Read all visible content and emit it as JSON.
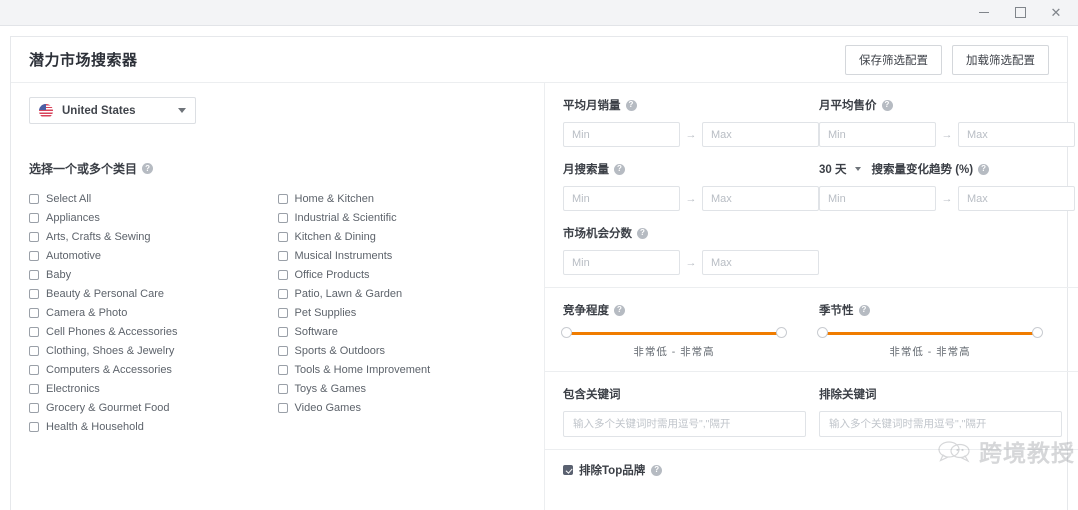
{
  "window": {
    "minimize_label": "—",
    "maximize_label": "□",
    "close_label": "✕"
  },
  "header": {
    "title": "潜力市场搜索器",
    "save_button": "保存筛选配置",
    "load_button": "加载筛选配置"
  },
  "country": {
    "label": "United States",
    "icon": "us-flag-icon"
  },
  "categories": {
    "section_label": "选择一个或多个类目",
    "column1": [
      "Select All",
      "Appliances",
      "Arts, Crafts & Sewing",
      "Automotive",
      "Baby",
      "Beauty & Personal Care",
      "Camera & Photo",
      "Cell Phones & Accessories",
      "Clothing, Shoes & Jewelry",
      "Computers & Accessories",
      "Electronics",
      "Grocery & Gourmet Food",
      "Health & Household"
    ],
    "column2": [
      "Home & Kitchen",
      "Industrial & Scientific",
      "Kitchen & Dining",
      "Musical Instruments",
      "Office Products",
      "Patio, Lawn & Garden",
      "Pet Supplies",
      "Software",
      "Sports & Outdoors",
      "Tools & Home Improvement",
      "Toys & Games",
      "Video Games"
    ]
  },
  "filters": {
    "avg_monthly_sales": {
      "label": "平均月销量",
      "min_placeholder": "Min",
      "min_value": "",
      "max_placeholder": "Max",
      "max_value": "",
      "arrow": "→"
    },
    "avg_monthly_price": {
      "label": "月平均售价",
      "min_placeholder": "Min",
      "min_value": "",
      "max_placeholder": "Max",
      "max_value": "",
      "arrow": "→"
    },
    "monthly_search_volume": {
      "label": "月搜索量",
      "min_placeholder": "Min",
      "min_value": "",
      "max_placeholder": "Max",
      "max_value": "",
      "arrow": "→"
    },
    "search_trend": {
      "period_value": "30 天",
      "label": "搜索量变化趋势 (%)",
      "min_placeholder": "Min",
      "min_value": "",
      "max_placeholder": "Max",
      "max_value": "",
      "arrow": "→"
    },
    "market_opportunity_score": {
      "label": "市场机会分数",
      "min_placeholder": "Min",
      "min_value": "",
      "max_placeholder": "Max",
      "max_value": "",
      "arrow": "→"
    }
  },
  "sliders": {
    "competition": {
      "label": "竞争程度",
      "caption": "非常低 - 非常高",
      "range_low": 0,
      "range_high": 100
    },
    "seasonality": {
      "label": "季节性",
      "caption": "非常低 - 非常高",
      "range_low": 0,
      "range_high": 100
    }
  },
  "keywords": {
    "include": {
      "label": "包含关键词",
      "placeholder": "输入多个关键词时需用逗号\",\"隔开",
      "value": ""
    },
    "exclude": {
      "label": "排除关键词",
      "placeholder": "输入多个关键词时需用逗号\",\"隔开",
      "value": ""
    }
  },
  "bottom": {
    "exclude_top_brands_label": "排除Top品牌",
    "exclude_top_brands_checked": true
  },
  "watermark": {
    "text": "跨境教授"
  },
  "icons": {
    "help": "?"
  },
  "colors": {
    "slider_track": "#f07c00",
    "checkbox_checked": "#5a6170",
    "border": "#e6e8eb",
    "text_primary": "#3b3f46"
  }
}
